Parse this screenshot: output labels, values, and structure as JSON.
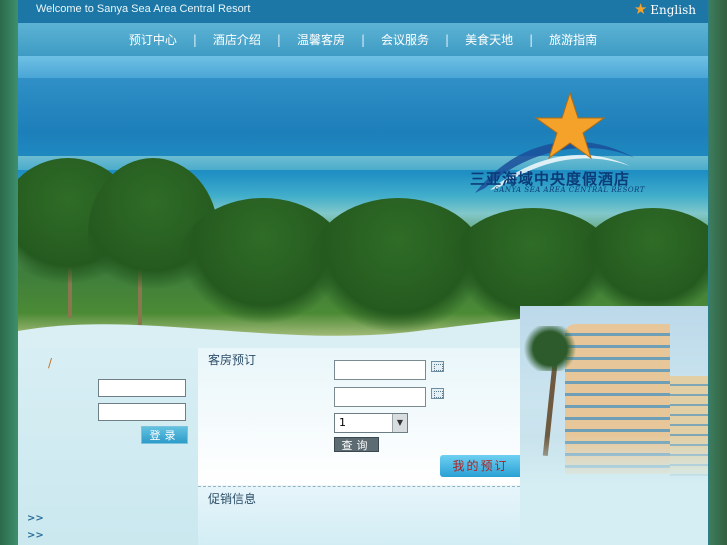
{
  "header": {
    "welcome_text": "Welcome to Sanya Sea Area Central Resort",
    "language_label": "English",
    "language_icon": "star-icon"
  },
  "nav": {
    "items": [
      "预订中心",
      "酒店介绍",
      "温馨客房",
      "会议服务",
      "美食天地",
      "旅游指南"
    ],
    "separator": "|"
  },
  "banner": {
    "logo_cn": "三亚海域中央度假酒店",
    "logo_en": "SANYA SEA AREA CENTRAL RESORT"
  },
  "login": {
    "slash_text": "/",
    "username_value": "",
    "password_value": "",
    "button_label": "登录",
    "links": [
      ">>",
      ">>"
    ]
  },
  "booking": {
    "title": "客房预订",
    "checkin_value": "",
    "checkout_value": "",
    "rooms_selected": "1",
    "query_label": "查询",
    "my_booking_label": "我的预订"
  },
  "promo": {
    "title": "促销信息"
  },
  "colors": {
    "topbar": "#1d77a6",
    "nav": "#4aa6cd",
    "accent_star": "#f4a22a",
    "logo_text": "#0b3c78"
  }
}
